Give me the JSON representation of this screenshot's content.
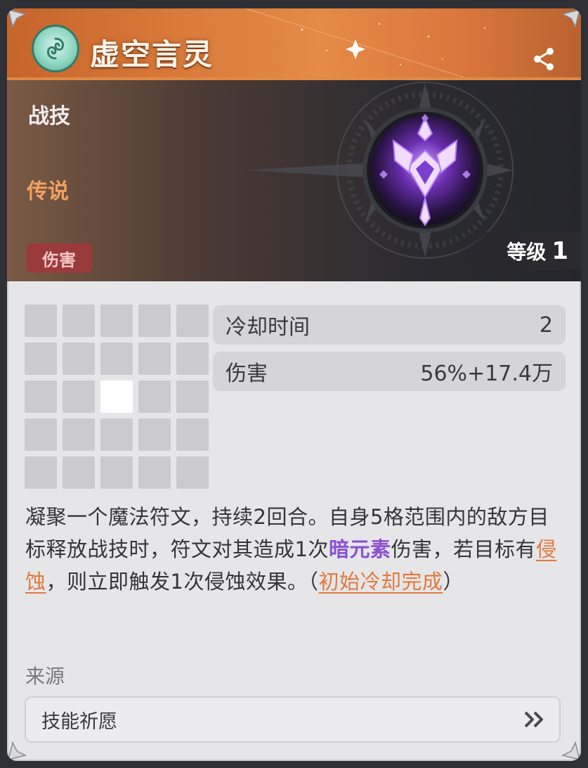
{
  "header": {
    "title": "虚空言灵"
  },
  "banner": {
    "skill_type": "战技",
    "rarity": "传说",
    "tag": "伤害",
    "level_label": "等级",
    "level_value": "1"
  },
  "range_grid": {
    "rows": 5,
    "cols": 5,
    "active_cell": [
      2,
      2
    ]
  },
  "stats": [
    {
      "label": "冷却时间",
      "value": "2"
    },
    {
      "label": "伤害",
      "value": "56%+17.4万"
    }
  ],
  "description": {
    "part1": "凝聚一个魔法符文，持续2回合。自身5格范围内的敌方目标释放战技时，符文对其造成1次",
    "keyword1": "暗元素",
    "part2": "伤害，若目标有",
    "keyword2": "侵蚀",
    "part3": "，则立即触发1次侵蚀效果。（",
    "keyword3": "初始冷却完成",
    "part4": "）"
  },
  "source": {
    "label": "来源",
    "item": "技能祈愿"
  },
  "colors": {
    "header_orange": "#d97a3a",
    "rarity": "#f1a15f",
    "damage_tag": "#9b3a3c",
    "element_purple": "#8a52d1",
    "link_orange": "#e1793b"
  },
  "icons": [
    "element-badge-icon",
    "share-icon",
    "skill-emblem-icon",
    "double-chevron-right-icon"
  ]
}
